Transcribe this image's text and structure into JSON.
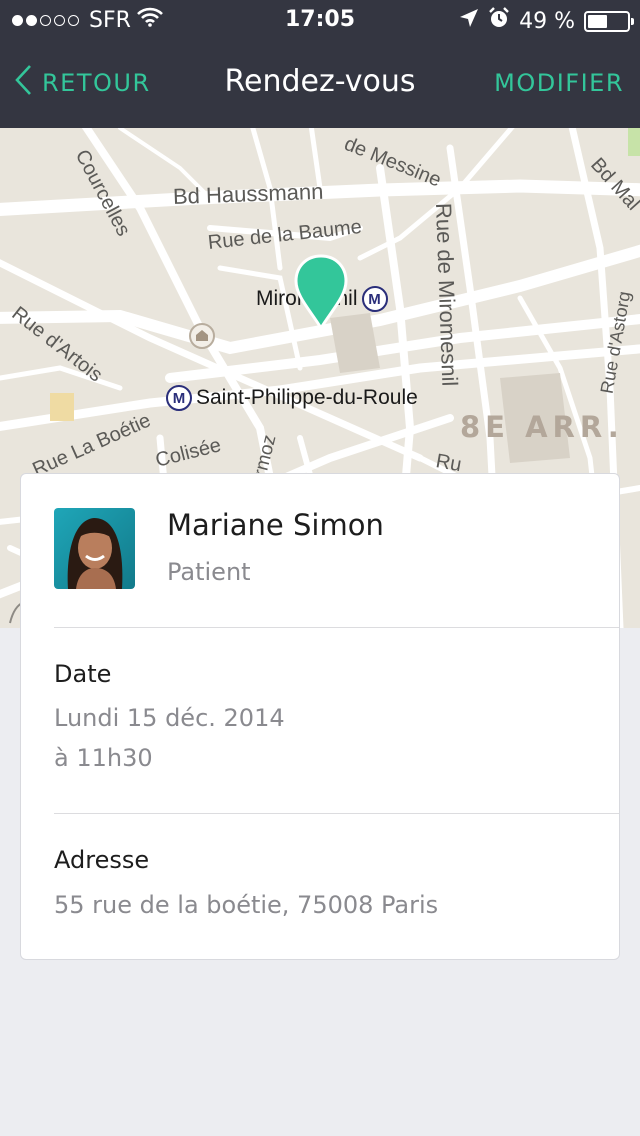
{
  "status_bar": {
    "carrier": "SFR",
    "signal_bars_filled": 2,
    "signal_bars_total": 5,
    "time": "17:05",
    "battery_percent": "49 %",
    "battery_level": 0.49,
    "icons": [
      "wifi-icon",
      "location-arrow-icon",
      "alarm-icon",
      "battery-icon"
    ]
  },
  "nav": {
    "back_label": "RETOUR",
    "title": "Rendez-vous",
    "edit_label": "MODIFIER"
  },
  "map": {
    "streets": {
      "courcelles": "Courcelles",
      "haussmann": "Bd Haussmann",
      "messine": "de Messine",
      "bd_mal": "Bd Mal",
      "baume": "Rue de la Baume",
      "miromesnil": "Rue de Miromesnil",
      "astorg": "Rue d'Astorg",
      "artois": "Rue d'Artois",
      "boetie": "Rue La Boétie",
      "colisee": "Colisée",
      "bermoz": "Bermoz",
      "ru": "Ru"
    },
    "poi": {
      "station_1": "Miromesnil",
      "station_2": "Saint-Philippe-du-Roule",
      "metro_symbol": "M"
    },
    "district": "8E ARR.",
    "colors": {
      "pin": "#33c69a",
      "land": "#e9e5dc",
      "road": "#ffffff"
    }
  },
  "patient": {
    "name": "Mariane Simon",
    "role": "Patient"
  },
  "date": {
    "label": "Date",
    "line1": "Lundi 15 déc. 2014",
    "line2": "à 11h30"
  },
  "address": {
    "label": "Adresse",
    "value": "55 rue de la boétie, 75008 Paris"
  },
  "colors": {
    "header_bg": "#343641",
    "accent": "#33c69a",
    "page_bg": "#ecedf1",
    "muted_text": "#8a8a8f"
  }
}
